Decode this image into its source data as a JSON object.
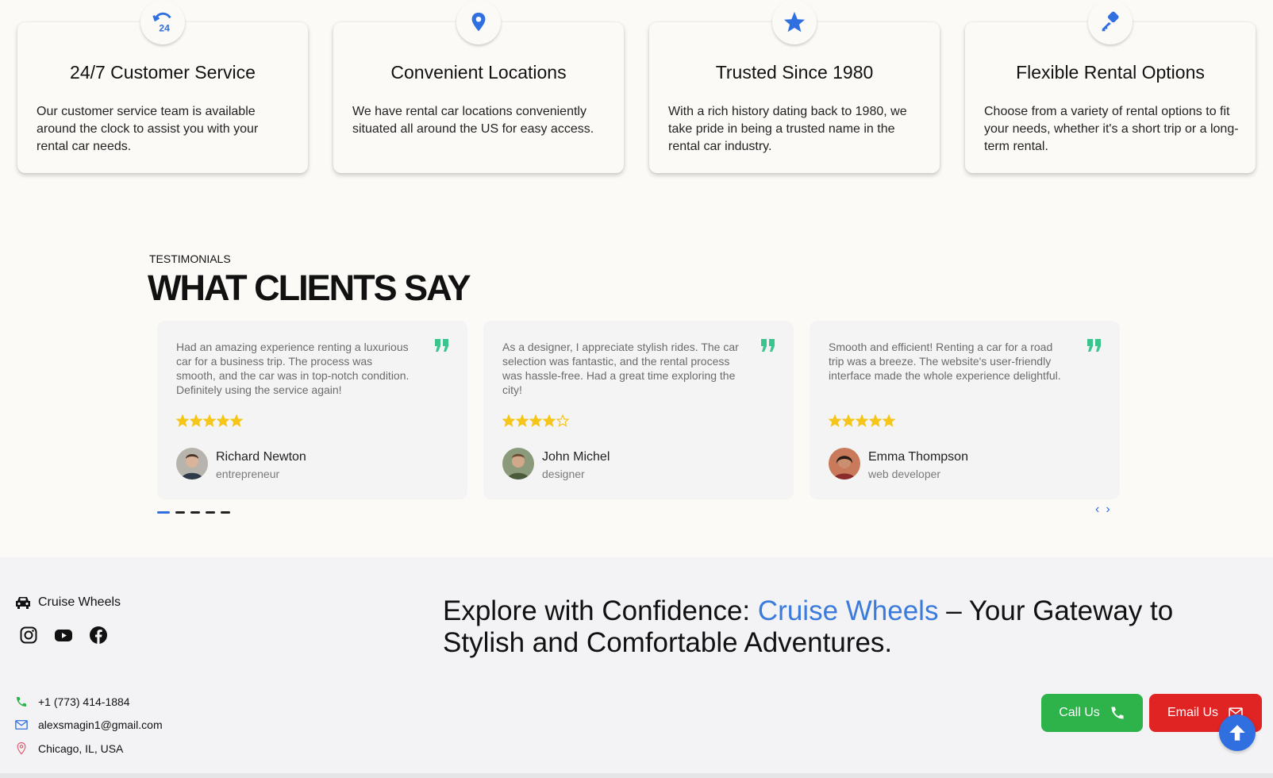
{
  "features": [
    {
      "icon": "24-hour-icon",
      "title": "24/7 Customer Service",
      "desc": "Our customer service team is available around the clock to assist you with your rental car needs."
    },
    {
      "icon": "location-pin-icon",
      "title": "Convenient Locations",
      "desc": "We have rental car locations conveniently situated all around the US for easy access."
    },
    {
      "icon": "star-icon",
      "title": "Trusted Since 1980",
      "desc": "With a rich history dating back to 1980, we take pride in being a trusted name in the rental car industry."
    },
    {
      "icon": "key-icon",
      "title": "Flexible Rental Options",
      "desc": "Choose from a variety of rental options to fit your needs, whether it's a short trip or a long-term rental."
    }
  ],
  "testimonials": {
    "kicker": "TESTIMONIALS",
    "title": "WHAT CLIENTS SAY",
    "items": [
      {
        "text": "Had an amazing experience renting a luxurious car for a business trip. The process was smooth, and the car was in top-notch condition. Definitely using the service again!",
        "rating": 5,
        "name": "Richard Newton",
        "role": "entrepreneur"
      },
      {
        "text": "As a designer, I appreciate stylish rides. The car selection was fantastic, and the rental process was hassle-free. Had a great time exploring the city!",
        "rating": 4,
        "name": "John Michel",
        "role": "designer"
      },
      {
        "text": "Smooth and efficient! Renting a car for a road trip was a breeze. The website's user-friendly interface made the whole experience delightful.",
        "rating": 5,
        "name": "Emma Thompson",
        "role": "web developer"
      }
    ],
    "pagination_active": 1,
    "pagination_total": 5,
    "prev_label": "‹",
    "next_label": "›"
  },
  "footer": {
    "brand": "Cruise Wheels",
    "socials": [
      "instagram-icon",
      "youtube-icon",
      "facebook-icon"
    ],
    "tagline_prefix": "Explore with Confidence: ",
    "tagline_accent": "Cruise Wheels",
    "tagline_suffix": " – Your Gateway to Stylish and Comfortable Adventures.",
    "phone": "+1 (773) 414-1884",
    "email": "alexsmagin1@gmail.com",
    "location": "Chicago, IL, USA",
    "call_label": "Call Us",
    "email_label": "Email Us"
  },
  "colors": {
    "accent": "#2f6fe0",
    "star": "#f5c518",
    "quote": "#3cc48e",
    "call": "#2db34a",
    "email": "#e02424"
  }
}
